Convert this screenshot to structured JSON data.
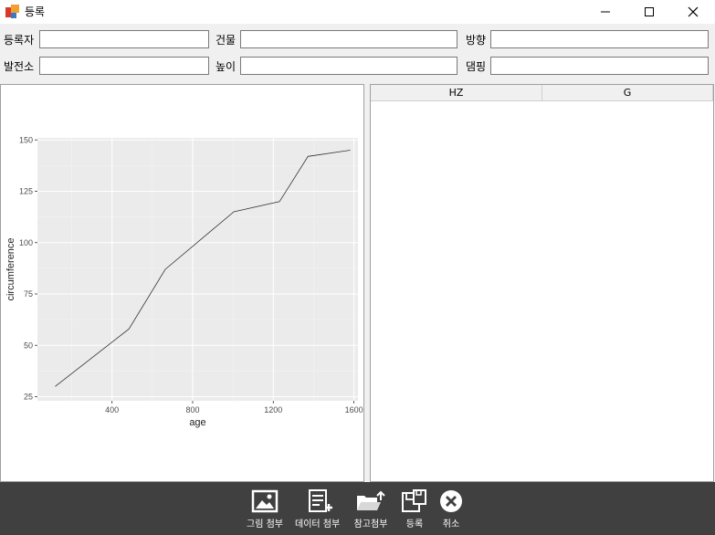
{
  "window": {
    "title": "등록"
  },
  "form": {
    "registrant_label": "등록자",
    "building_label": "건물",
    "direction_label": "방향",
    "plant_label": "발전소",
    "height_label": "높이",
    "damping_label": "댐핑",
    "registrant_value": "",
    "building_value": "",
    "direction_value": "",
    "plant_value": "",
    "height_value": "",
    "damping_value": ""
  },
  "grid": {
    "columns": [
      "HZ",
      "G"
    ]
  },
  "toolbar": {
    "attach_image_label": "그림 첨부",
    "attach_data_label": "데이터 첨부",
    "attach_reference_label": "참고첨부",
    "register_label": "등록",
    "cancel_label": "취소"
  },
  "chart_data": {
    "type": "line",
    "xlabel": "age",
    "ylabel": "circumference",
    "xlim": [
      30,
      1620
    ],
    "ylim": [
      23,
      151
    ],
    "xticks": [
      400,
      800,
      1200,
      1600
    ],
    "yticks": [
      25,
      50,
      75,
      100,
      125,
      150
    ],
    "grid": true,
    "series": [
      {
        "x": [
          118,
          484,
          664,
          1004,
          1231,
          1372,
          1582
        ],
        "y": [
          30,
          58,
          87,
          115,
          120,
          142,
          145
        ]
      }
    ]
  }
}
